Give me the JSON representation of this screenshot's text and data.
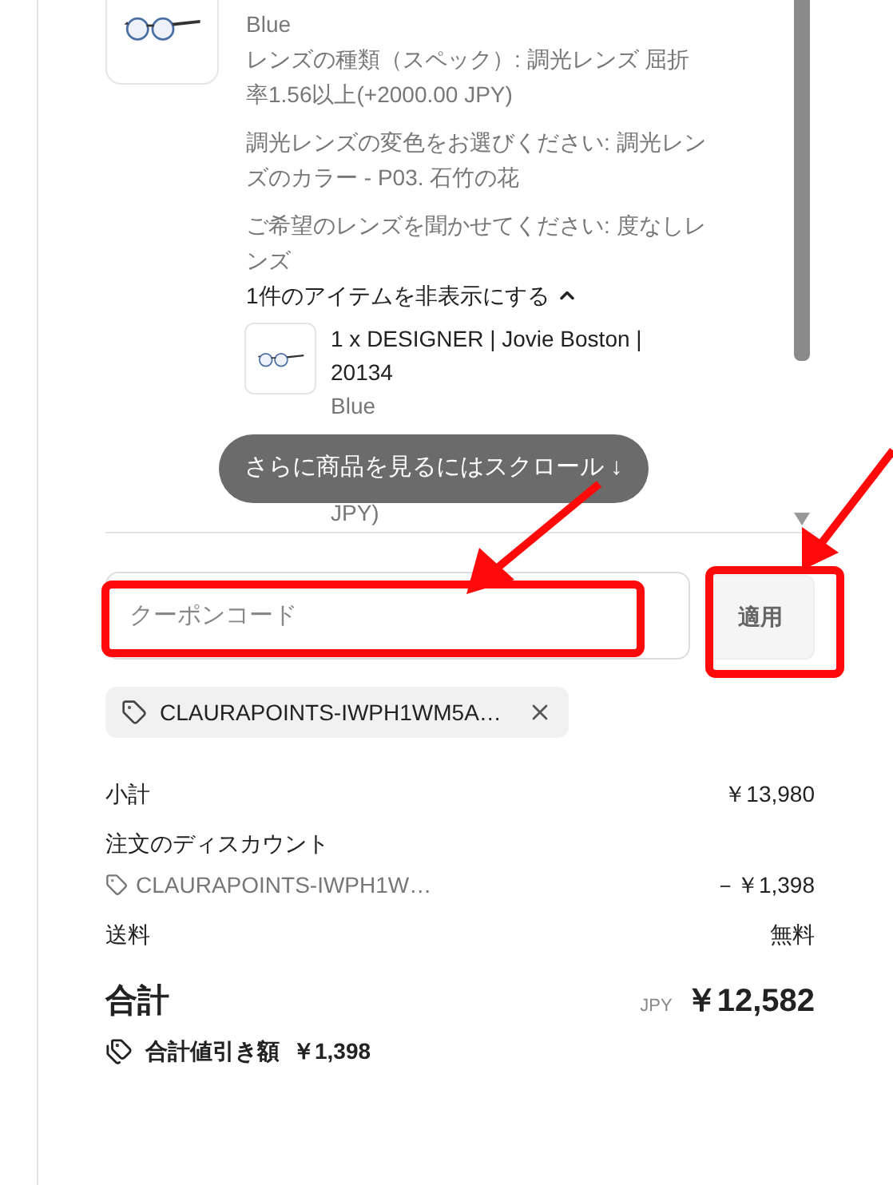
{
  "products": [
    {
      "variant": "Blue",
      "options": [
        "レンズの種類（スペック）: 調光レンズ 屈折率1.56以上(+2000.00 JPY)",
        "調光レンズの変色をお選びください: 調光レンズのカラー - P03. 石竹の花",
        "ご希望のレンズを聞かせてください: 度なしレンズ"
      ],
      "hidden_items_toggle": {
        "label": "1件のアイテムを非表示にする",
        "expanded": true
      },
      "children": [
        {
          "title": "1 x DESIGNER | Jovie Boston | 20134",
          "variant": "Blue",
          "options": [
            "JPY)"
          ]
        }
      ]
    }
  ],
  "scroll_hint": "さらに商品を見るにはスクロール ↓",
  "coupon": {
    "placeholder": "クーポンコード",
    "apply_button": "適用",
    "applied_code": "CLAURAPOINTS-IWPH1WM5A…"
  },
  "summary": {
    "rows": [
      {
        "kind": "line",
        "label": "小計",
        "value": "￥13,980"
      },
      {
        "kind": "heading",
        "label": "注文のディスカウント"
      },
      {
        "kind": "discount",
        "label": "CLAURAPOINTS-IWPH1W…",
        "value": "－￥1,398"
      },
      {
        "kind": "line",
        "label": "送料",
        "value": "無料"
      }
    ],
    "total": {
      "label": "合計",
      "currency": "JPY",
      "value": "￥12,582"
    },
    "savings": {
      "label": "合計値引き額",
      "value": "￥1,398"
    }
  }
}
